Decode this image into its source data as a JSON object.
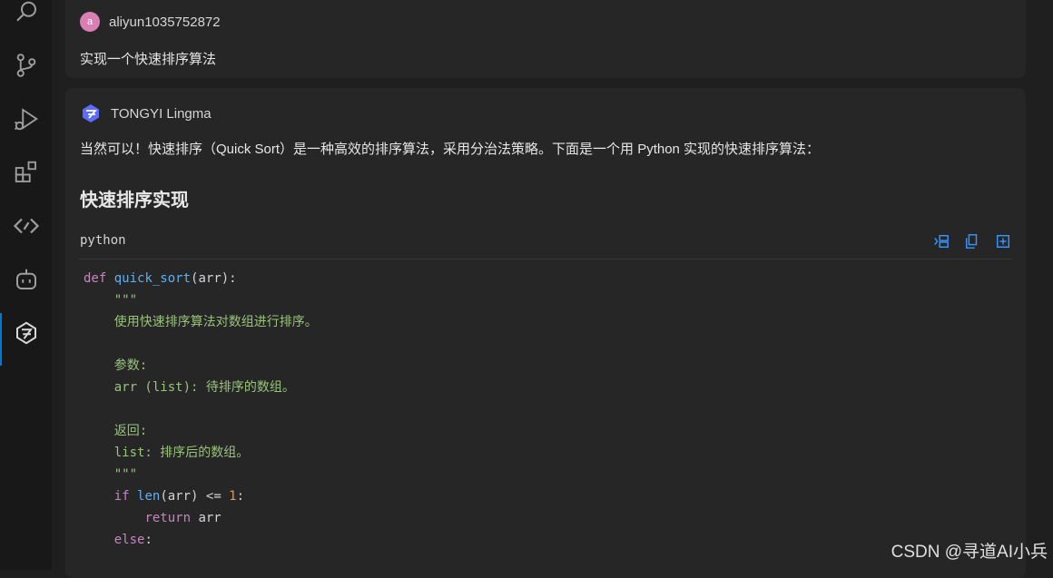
{
  "user_message": {
    "avatar_letter": "a",
    "author": "aliyun1035752872",
    "text": "实现一个快速排序算法"
  },
  "ai_message": {
    "author": "TONGYI Lingma",
    "intro": "当然可以！快速排序（Quick Sort）是一种高效的排序算法，采用分治法策略。下面是一个用 Python 实现的快速排序算法：",
    "heading": "快速排序实现",
    "code_language": "python",
    "code": {
      "l1_def": "def",
      "l1_fn": "quick_sort",
      "l1_rest": "(arr):",
      "l2": "    \"\"\"",
      "l3": "    使用快速排序算法对数组进行排序。",
      "l5": "    参数:",
      "l6": "    arr (list): 待排序的数组。",
      "l8": "    返回:",
      "l9": "    list: 排序后的数组。",
      "l10": "    \"\"\"",
      "l11_if": "if",
      "l11_len": "len",
      "l11_mid": "(arr) <= ",
      "l11_num": "1",
      "l11_end": ":",
      "l12_kw": "return",
      "l12_rest": " arr",
      "l13_kw": "else",
      "l13_end": ":"
    }
  },
  "icons": {
    "activity_bar": [
      "search-icon",
      "source-control-icon",
      "run-debug-icon",
      "extensions-icon",
      "remote-code-icon",
      "copilot-bot-icon",
      "tongyi-lingma-icon"
    ],
    "code_actions": [
      "insert-at-cursor-icon",
      "copy-icon",
      "new-file-icon"
    ]
  },
  "colors": {
    "accent": "#0078d4",
    "keyword": "#c586c0",
    "function": "#61afef",
    "string": "#98c379",
    "number": "#d19a66"
  },
  "watermark": "CSDN @寻道AI小兵"
}
